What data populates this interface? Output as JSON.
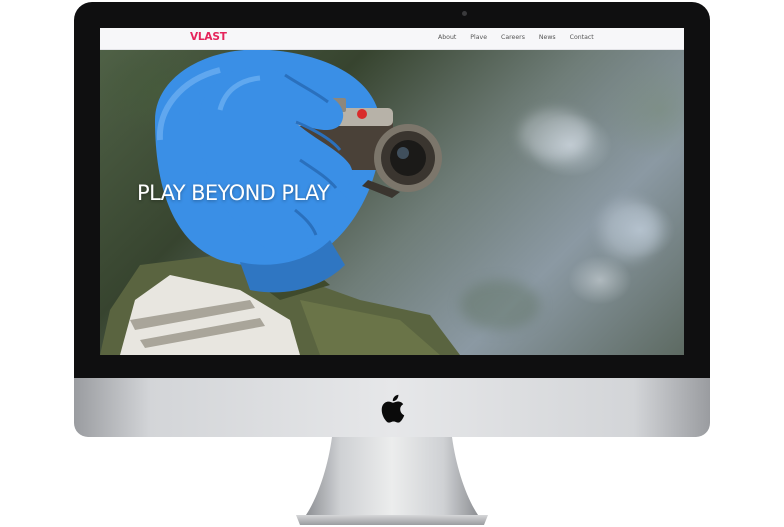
{
  "site": {
    "logo": "VLAST",
    "nav": [
      "About",
      "Plave",
      "Careers",
      "News",
      "Contact"
    ],
    "headline": "PLAY BEYOND PLAY"
  },
  "colors": {
    "brand": "#e5245b",
    "bezel": "#0f0f10",
    "navbar": "#f7f7f9",
    "hero_figure": "#3a8fe6"
  },
  "icons": {
    "device_logo": "apple-logo-icon",
    "camera": "webcam-dot-icon"
  }
}
